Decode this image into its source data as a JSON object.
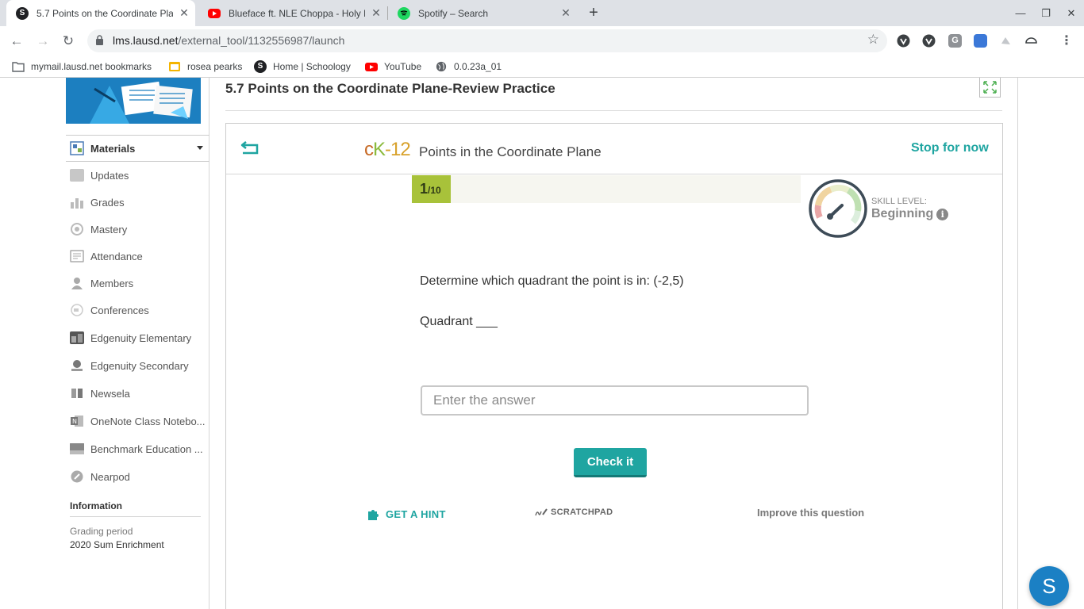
{
  "browser": {
    "tabs": [
      {
        "title": "5.7 Points on the Coordinate Pla",
        "favicon": "schoology-icon",
        "color": "#202124"
      },
      {
        "title": "Blueface ft. NLE Choppa - Holy M",
        "favicon": "youtube-icon",
        "color": "#ff0000"
      },
      {
        "title": "Spotify – Search",
        "favicon": "spotify-icon",
        "color": "#1ed760"
      }
    ],
    "url_host": "lms.lausd.net",
    "url_path": "/external_tool/1132556987/launch",
    "bookmarks": [
      {
        "label": "mymail.lausd.net bookmarks"
      },
      {
        "label": "rosea pearks"
      },
      {
        "label": "Home | Schoology"
      },
      {
        "label": "YouTube"
      },
      {
        "label": "0.0.23a_01"
      }
    ]
  },
  "sidebar": {
    "materials_label": "Materials",
    "items": [
      {
        "label": "Updates",
        "icon": "updates-icon"
      },
      {
        "label": "Grades",
        "icon": "grades-icon"
      },
      {
        "label": "Mastery",
        "icon": "mastery-icon"
      },
      {
        "label": "Attendance",
        "icon": "attendance-icon"
      },
      {
        "label": "Members",
        "icon": "members-icon"
      },
      {
        "label": "Conferences",
        "icon": "conferences-icon"
      },
      {
        "label": "Edgenuity Elementary",
        "icon": "edgenuity-elementary-icon"
      },
      {
        "label": "Edgenuity Secondary",
        "icon": "edgenuity-secondary-icon"
      },
      {
        "label": "Newsela",
        "icon": "newsela-icon"
      },
      {
        "label": "OneNote Class Notebo...",
        "icon": "onenote-icon"
      },
      {
        "label": "Benchmark Education ...",
        "icon": "benchmark-icon"
      },
      {
        "label": "Nearpod",
        "icon": "nearpod-icon"
      }
    ],
    "info_title": "Information",
    "grading_label": "Grading period",
    "grading_value": "2020 Sum Enrichment"
  },
  "main": {
    "page_title": "5.7 Points on the Coordinate Plane-Review Practice"
  },
  "ck12": {
    "logo": {
      "c": "c",
      "k": "K",
      "rest": "-12"
    },
    "heading": "Points in the Coordinate Plane",
    "stop_label": "Stop for now",
    "progress": {
      "current": "1",
      "total": "/10",
      "fraction": 0.1
    },
    "skill_label": "SKILL LEVEL:",
    "skill_value": "Beginning",
    "question": "Determine which quadrant the point is in: (-2,5)",
    "prompt": "Quadrant ___",
    "answer_placeholder": "Enter the answer",
    "check_label": "Check it",
    "hint_label": "GET A HINT",
    "scratchpad_label": "SCRATCHPAD",
    "improve_label": "Improve this question",
    "accent_color": "#1fa5a1"
  },
  "chat": {
    "letter": "S"
  }
}
